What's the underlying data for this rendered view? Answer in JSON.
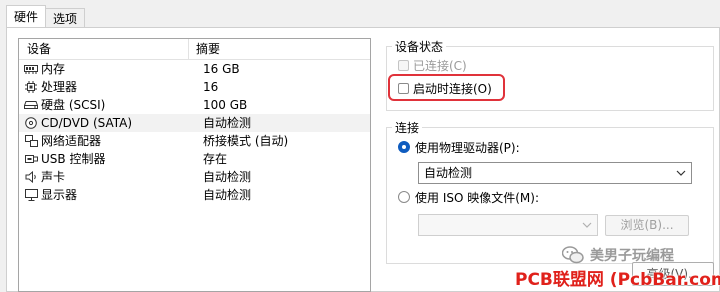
{
  "tabs": [
    {
      "label": "硬件",
      "active": true
    },
    {
      "label": "选项",
      "active": false
    }
  ],
  "device_list": {
    "columns": {
      "device": "设备",
      "summary": "摘要"
    },
    "rows": [
      {
        "icon": "memory-icon",
        "name": "内存",
        "summary": "16 GB"
      },
      {
        "icon": "processor-icon",
        "name": "处理器",
        "summary": "16"
      },
      {
        "icon": "hard-disk-icon",
        "name": "硬盘 (SCSI)",
        "summary": "100 GB"
      },
      {
        "icon": "cd-dvd-icon",
        "name": "CD/DVD (SATA)",
        "summary": "自动检测",
        "selected": true
      },
      {
        "icon": "network-adapter-icon",
        "name": "网络适配器",
        "summary": "桥接模式 (自动)"
      },
      {
        "icon": "usb-icon",
        "name": "USB 控制器",
        "summary": "存在"
      },
      {
        "icon": "sound-card-icon",
        "name": "声卡",
        "summary": "自动检测"
      },
      {
        "icon": "display-icon",
        "name": "显示器",
        "summary": "自动检测"
      }
    ]
  },
  "device_status": {
    "title": "设备状态",
    "connected_label": "已连接(C)",
    "connect_at_power_on_label": "启动时连接(O)",
    "highlight_color": "#e0323a"
  },
  "connection": {
    "title": "连接",
    "physical_drive_label": "使用物理驱动器(P):",
    "physical_drive_value": "自动检测",
    "iso_label": "使用 ISO 映像文件(M):",
    "iso_value": "",
    "browse_label": "浏览(B)...",
    "accent_color": "#0f5cbf"
  },
  "advanced_button_label": "高级(V)...",
  "watermarks": {
    "wechat_text": "美男子玩编程",
    "site_text": "PCB联盟网 (PcbBar.com)"
  }
}
